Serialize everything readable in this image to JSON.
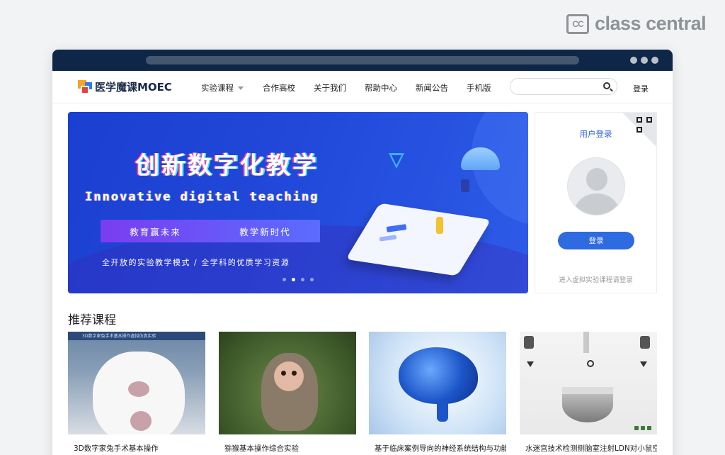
{
  "watermark": {
    "badge": "CC",
    "text": "class central"
  },
  "site": {
    "name": "医学魔课MOEC"
  },
  "nav": {
    "items": [
      {
        "label": "实验课程"
      },
      {
        "label": "合作高校"
      },
      {
        "label": "关于我们"
      },
      {
        "label": "帮助中心"
      },
      {
        "label": "新闻公告"
      },
      {
        "label": "手机版"
      }
    ],
    "search_value": "",
    "login_label": "登录"
  },
  "banner": {
    "title": "创新数字化教学",
    "subtitle": "Innovative digital teaching",
    "pill_left": "教育赢未来",
    "pill_right": "教学新时代",
    "tagline": "全开放的实验教学模式  /  全学科的优质学习资源",
    "slide_count": 4,
    "active_slide": 2
  },
  "login_panel": {
    "title": "用户登录",
    "button_label": "登录",
    "hint": "进入虚拟实验课程请登录"
  },
  "section": {
    "title": "推荐课程"
  },
  "courses": [
    {
      "caption": "3D数字家兔手术基本操作",
      "thumb_banner": "3D数字家兔手术基本操作虚拟仿真实验",
      "image": "rabbit"
    },
    {
      "caption": "猕猴基本操作综合实验",
      "image": "monkey"
    },
    {
      "caption": "基于临床案例导向的神经系统结构与功能",
      "image": "brain"
    },
    {
      "caption": "水迷宫技术检测侧脑室注射LDN对小鼠空",
      "image": "lab"
    }
  ],
  "colors": {
    "titlebar": "#0e2748",
    "accent": "#2e6ae0",
    "banner_start": "#1b3fd1",
    "banner_end": "#2d5ce8"
  }
}
